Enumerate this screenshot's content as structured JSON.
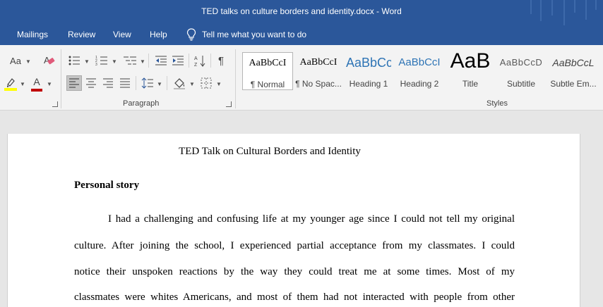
{
  "window": {
    "title": "TED talks on culture borders and identity.docx  -  Word"
  },
  "menu": {
    "tabs": [
      "Mailings",
      "Review",
      "View",
      "Help"
    ],
    "tell_me": "Tell me what you want to do"
  },
  "ribbon": {
    "font_group": {
      "change_case": "Aa",
      "font_color_letter": "A"
    },
    "paragraph_group": {
      "label": "Paragraph"
    },
    "styles_group": {
      "label": "Styles",
      "items": [
        {
          "sample": "AaBbCcI",
          "name": "¶ Normal"
        },
        {
          "sample": "AaBbCcI",
          "name": "¶ No Spac..."
        },
        {
          "sample": "AaBbCc",
          "name": "Heading 1"
        },
        {
          "sample": "AaBbCcI",
          "name": "Heading 2"
        },
        {
          "sample": "AaB",
          "name": "Title"
        },
        {
          "sample": "AaBbCcD",
          "name": "Subtitle"
        },
        {
          "sample": "AaBbCcL",
          "name": "Subtle Em..."
        }
      ]
    }
  },
  "document": {
    "title": "TED Talk on Cultural Borders and Identity",
    "heading": "Personal story",
    "paragraph_lines": [
      "I had a challenging and confusing life at my younger age since I could not tell my original",
      "culture. After joining the school, I experienced partial acceptance from my classmates. I could",
      "notice their unspoken reactions by the way they could treat me at some times. Most of my",
      "classmates were whites Americans, and most of them had not interacted with people from other"
    ]
  },
  "colors": {
    "accent": "#2b579a",
    "font_color_red": "#c00000",
    "highlight_yellow": "#ffff00",
    "heading_blue": "#2e74b5"
  }
}
